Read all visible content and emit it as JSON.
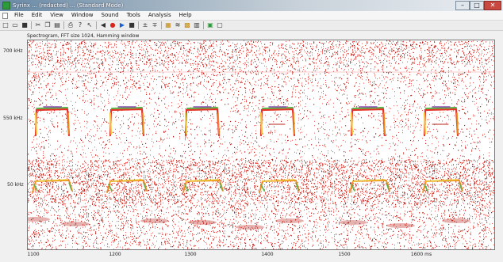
{
  "window": {
    "title": "Syrinx ... (redacted) ... (Standard Mode)",
    "controls": {
      "minimize": "–",
      "maximize": "□",
      "close": "✕"
    }
  },
  "menu": {
    "items": [
      "File",
      "Edit",
      "View",
      "Window",
      "Sound",
      "Tools",
      "Analysis",
      "Help"
    ]
  },
  "toolbar": {
    "buttons": [
      {
        "name": "new-icon",
        "glyph": "□"
      },
      {
        "name": "open-icon",
        "glyph": "▭"
      },
      {
        "name": "save-icon",
        "glyph": "■"
      },
      {
        "name": "sep-1",
        "glyph": ""
      },
      {
        "name": "cut-icon",
        "glyph": "✂"
      },
      {
        "name": "copy-icon",
        "glyph": "❐"
      },
      {
        "name": "paste-icon",
        "glyph": "▤"
      },
      {
        "name": "sep-2",
        "glyph": ""
      },
      {
        "name": "print-icon",
        "glyph": "⎙"
      },
      {
        "name": "help-icon",
        "glyph": "?"
      },
      {
        "name": "pointer-icon",
        "glyph": "↖"
      },
      {
        "name": "sep-3",
        "glyph": ""
      },
      {
        "name": "rewind-icon",
        "glyph": "◀"
      },
      {
        "name": "record-icon",
        "glyph": "●"
      },
      {
        "name": "play-icon",
        "glyph": "▶"
      },
      {
        "name": "stop-icon",
        "glyph": "■"
      },
      {
        "name": "sep-4",
        "glyph": ""
      },
      {
        "name": "zoom-in-icon",
        "glyph": "±"
      },
      {
        "name": "zoom-out-icon",
        "glyph": "∓"
      },
      {
        "name": "sep-5",
        "glyph": ""
      },
      {
        "name": "spectrogram-icon",
        "glyph": "▦"
      },
      {
        "name": "waveform-icon",
        "glyph": "≋"
      },
      {
        "name": "color-icon",
        "glyph": "▩"
      },
      {
        "name": "table-icon",
        "glyph": "▥"
      },
      {
        "name": "sep-6",
        "glyph": ""
      },
      {
        "name": "mark-icon",
        "glyph": "▣"
      },
      {
        "name": "settings-icon",
        "glyph": "▢"
      }
    ]
  },
  "spectrogram": {
    "subtitle": "Spectrogram, FFT size 1024, Hamming window",
    "y_labels": [
      "700 kHz",
      "550 kHz",
      "50 kHz"
    ],
    "x_labels": [
      "1100",
      "1200",
      "1300",
      "1400",
      "1500",
      "1600 ms"
    ]
  },
  "colors": {
    "noise": "#e6332a",
    "noise_dark": "#b8231b",
    "call_green": "#5cb34a",
    "call_yellow": "#e8c531",
    "call_purple": "#8a4bb0",
    "call_orange": "#f08a1c"
  }
}
